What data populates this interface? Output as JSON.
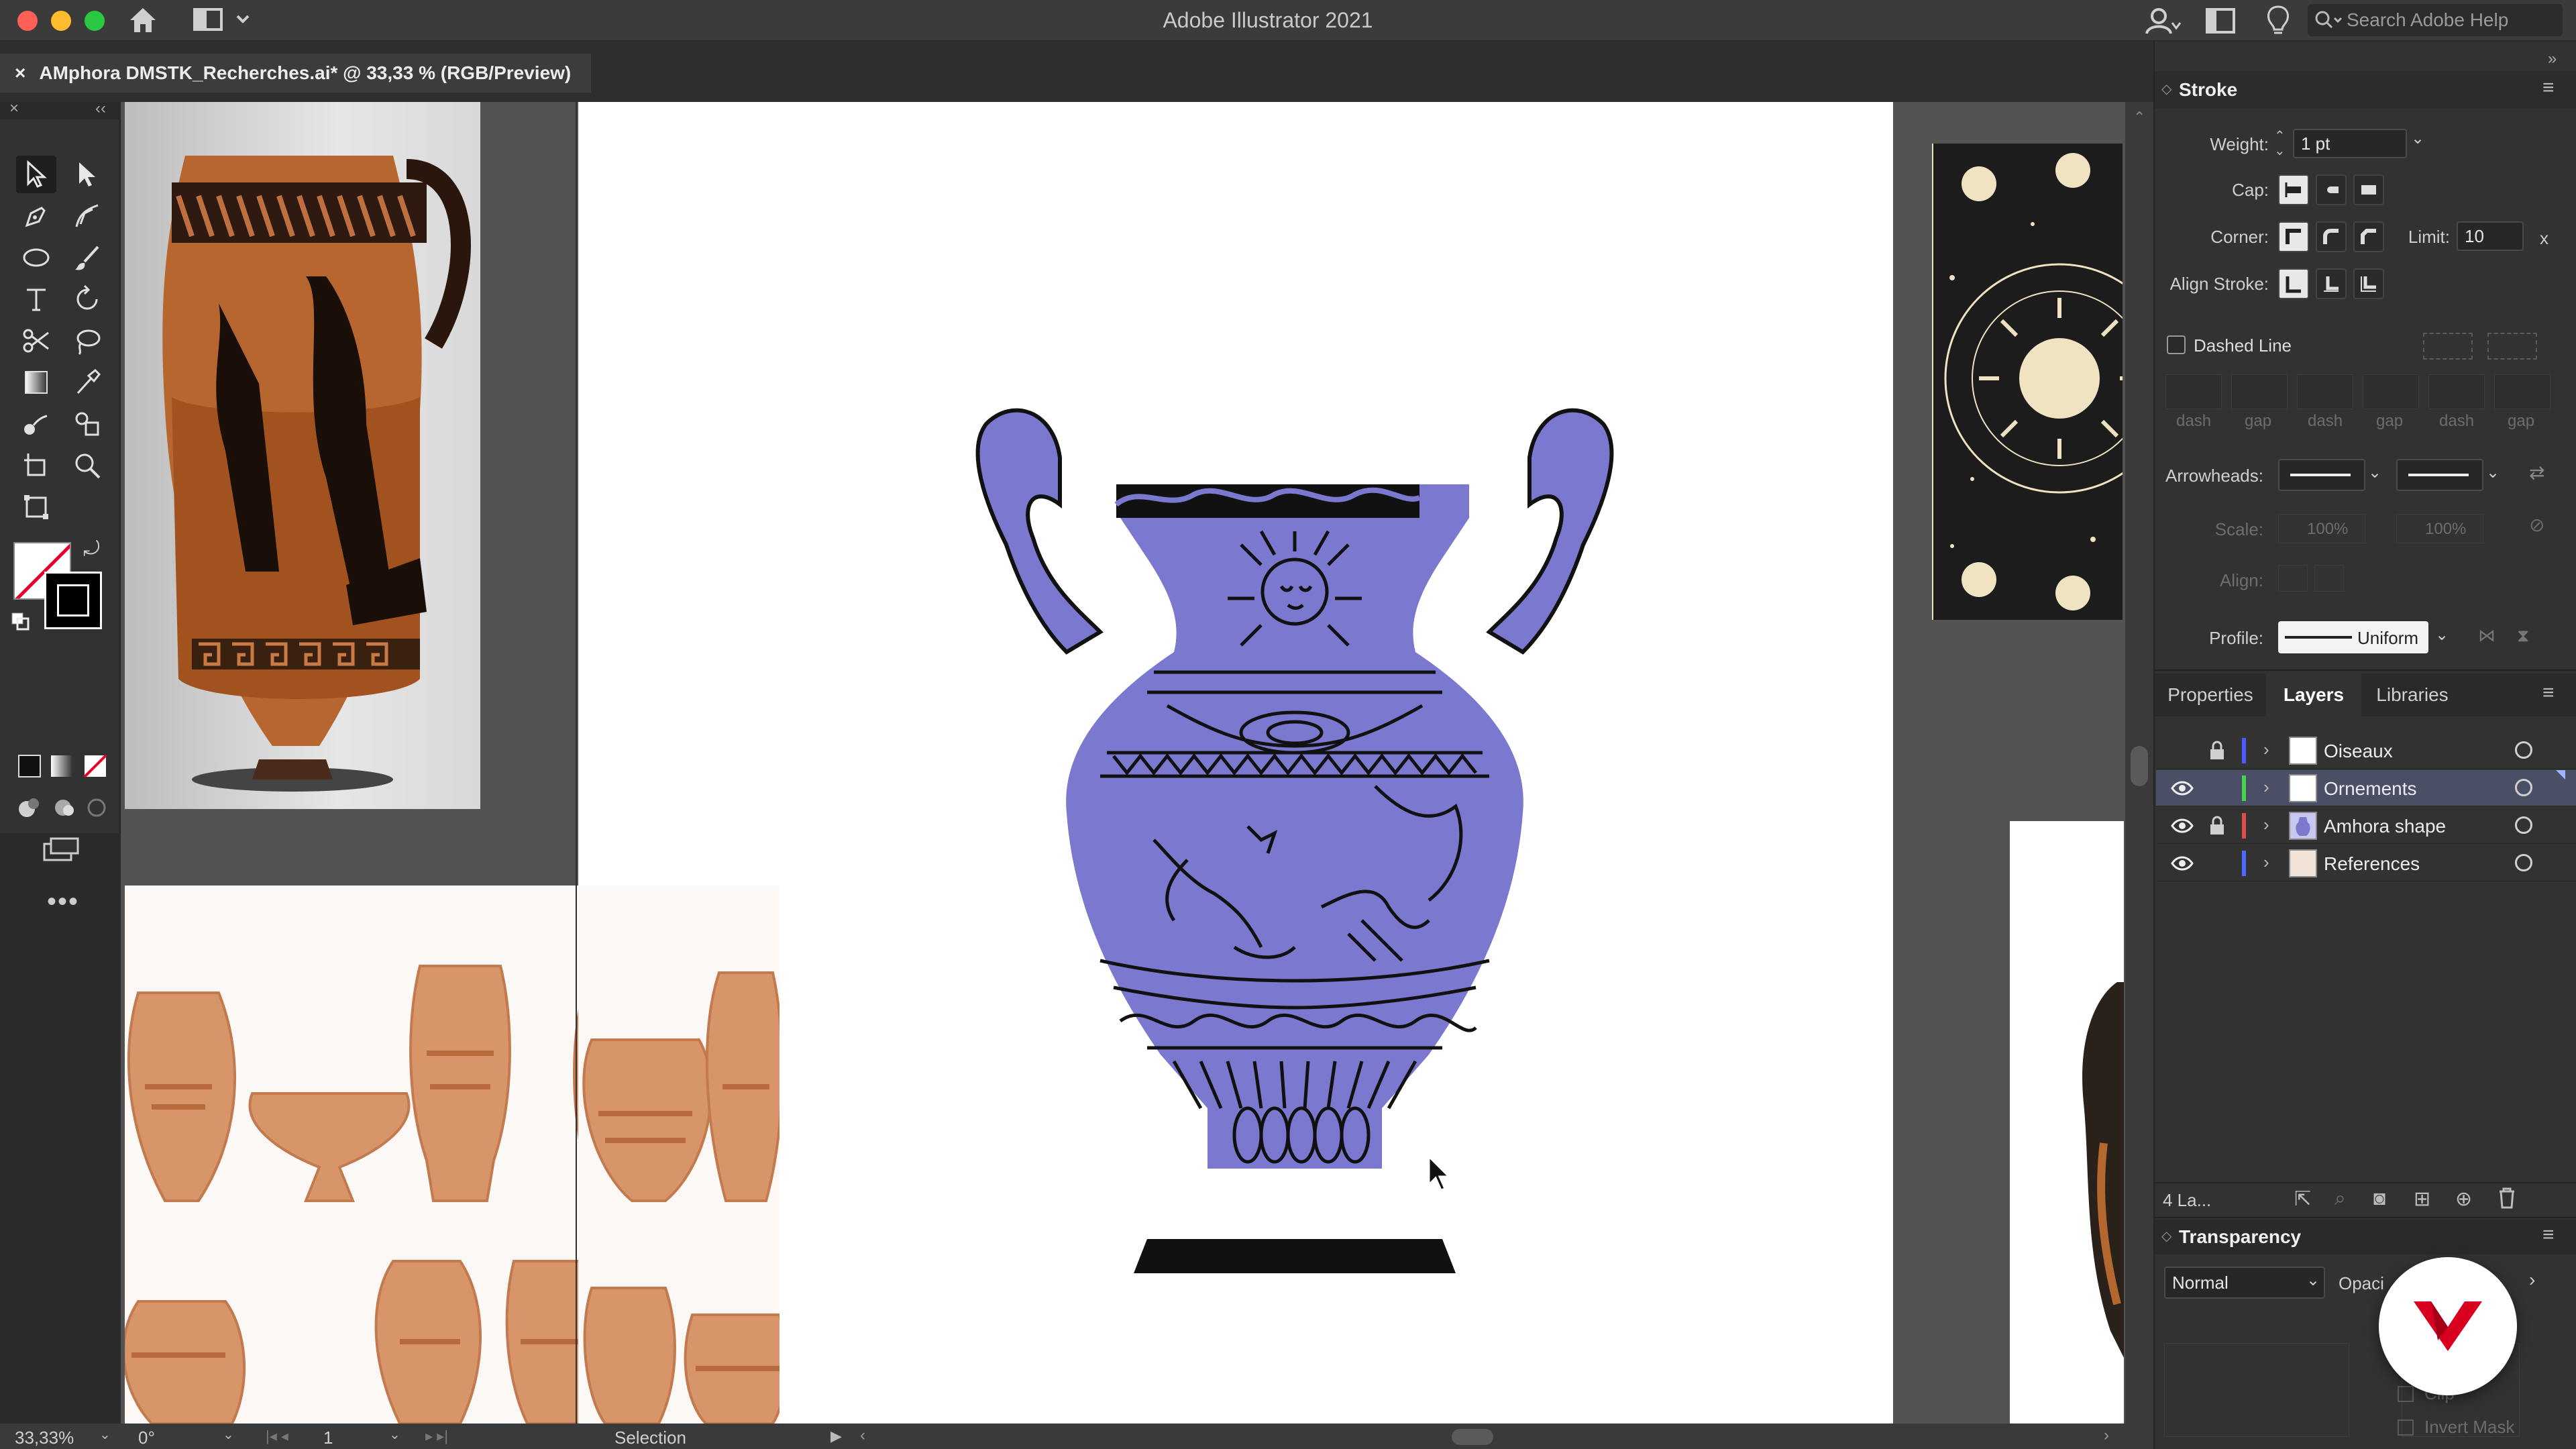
{
  "app": {
    "title": "Adobe Illustrator 2021",
    "help_search_placeholder": "Search Adobe Help"
  },
  "document_tab": {
    "close_glyph": "×",
    "label": "AMphora DMSTK_Recherches.ai* @ 33,33 % (RGB/Preview)"
  },
  "status_bar": {
    "zoom": "33,33%",
    "rotation": "0°",
    "artboard": "1",
    "tool": "Selection"
  },
  "stroke_panel": {
    "title": "Stroke",
    "weight_label": "Weight:",
    "weight_value": "1 pt",
    "cap_label": "Cap:",
    "corner_label": "Corner:",
    "limit_label": "Limit:",
    "limit_value": "10",
    "limit_suffix": "x",
    "align_label": "Align Stroke:",
    "dashed_label": "Dashed Line",
    "dash_labels": [
      "dash",
      "gap",
      "dash",
      "gap",
      "dash",
      "gap"
    ],
    "arrowheads_label": "Arrowheads:",
    "scale_label": "Scale:",
    "scale_value_1": "100%",
    "scale_value_2": "100%",
    "align_arrow_label": "Align:",
    "profile_label": "Profile:",
    "profile_value": "Uniform"
  },
  "panel_tabs": [
    "Properties",
    "Layers",
    "Libraries"
  ],
  "layers": [
    {
      "name": "Oiseaux",
      "visible": false,
      "locked": true,
      "color": "#4a5cff",
      "selected": false
    },
    {
      "name": "Ornements",
      "visible": true,
      "locked": false,
      "color": "#46d44e",
      "selected": true
    },
    {
      "name": "Amhora shape",
      "visible": true,
      "locked": true,
      "color": "#e24b4b",
      "selected": false
    },
    {
      "name": "References",
      "visible": true,
      "locked": false,
      "color": "#4a6bff",
      "selected": false
    }
  ],
  "layers_footer": {
    "count": "4 La..."
  },
  "transparency_panel": {
    "title": "Transparency",
    "blend_mode": "Normal",
    "opacity_label": "Opaci",
    "clip_label": "Clip",
    "invert_mask_label": "Invert Mask"
  },
  "colors": {
    "vase_fill": "#7b78cf",
    "vase_line": "#111111",
    "selection_highlight": "#4a4f66",
    "terracotta": "#d9956a",
    "brand_red": "#d8001e"
  }
}
